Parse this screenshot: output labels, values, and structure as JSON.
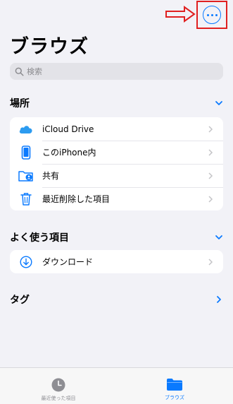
{
  "header": {
    "title": "ブラウズ",
    "more_icon": "ellipsis-circle-icon",
    "annotation_color": "#e02020"
  },
  "search": {
    "placeholder": "検索"
  },
  "locations": {
    "header": "場所",
    "items": [
      {
        "label": "iCloud Drive",
        "icon": "icloud-icon"
      },
      {
        "label": "このiPhone内",
        "icon": "iphone-icon"
      },
      {
        "label": "共有",
        "icon": "shared-folder-icon"
      },
      {
        "label": "最近削除した項目",
        "icon": "trash-icon"
      }
    ]
  },
  "favorites": {
    "header": "よく使う項目",
    "items": [
      {
        "label": "ダウンロード",
        "icon": "download-icon"
      }
    ]
  },
  "tags": {
    "header": "タグ"
  },
  "tab_bar": {
    "tabs": [
      {
        "label": "最近使った項目",
        "icon": "clock-icon",
        "selected": false
      },
      {
        "label": "ブラウズ",
        "icon": "folder-icon",
        "selected": true
      }
    ]
  },
  "colors": {
    "accent": "#0a7aff",
    "background": "#f2f2f7"
  }
}
